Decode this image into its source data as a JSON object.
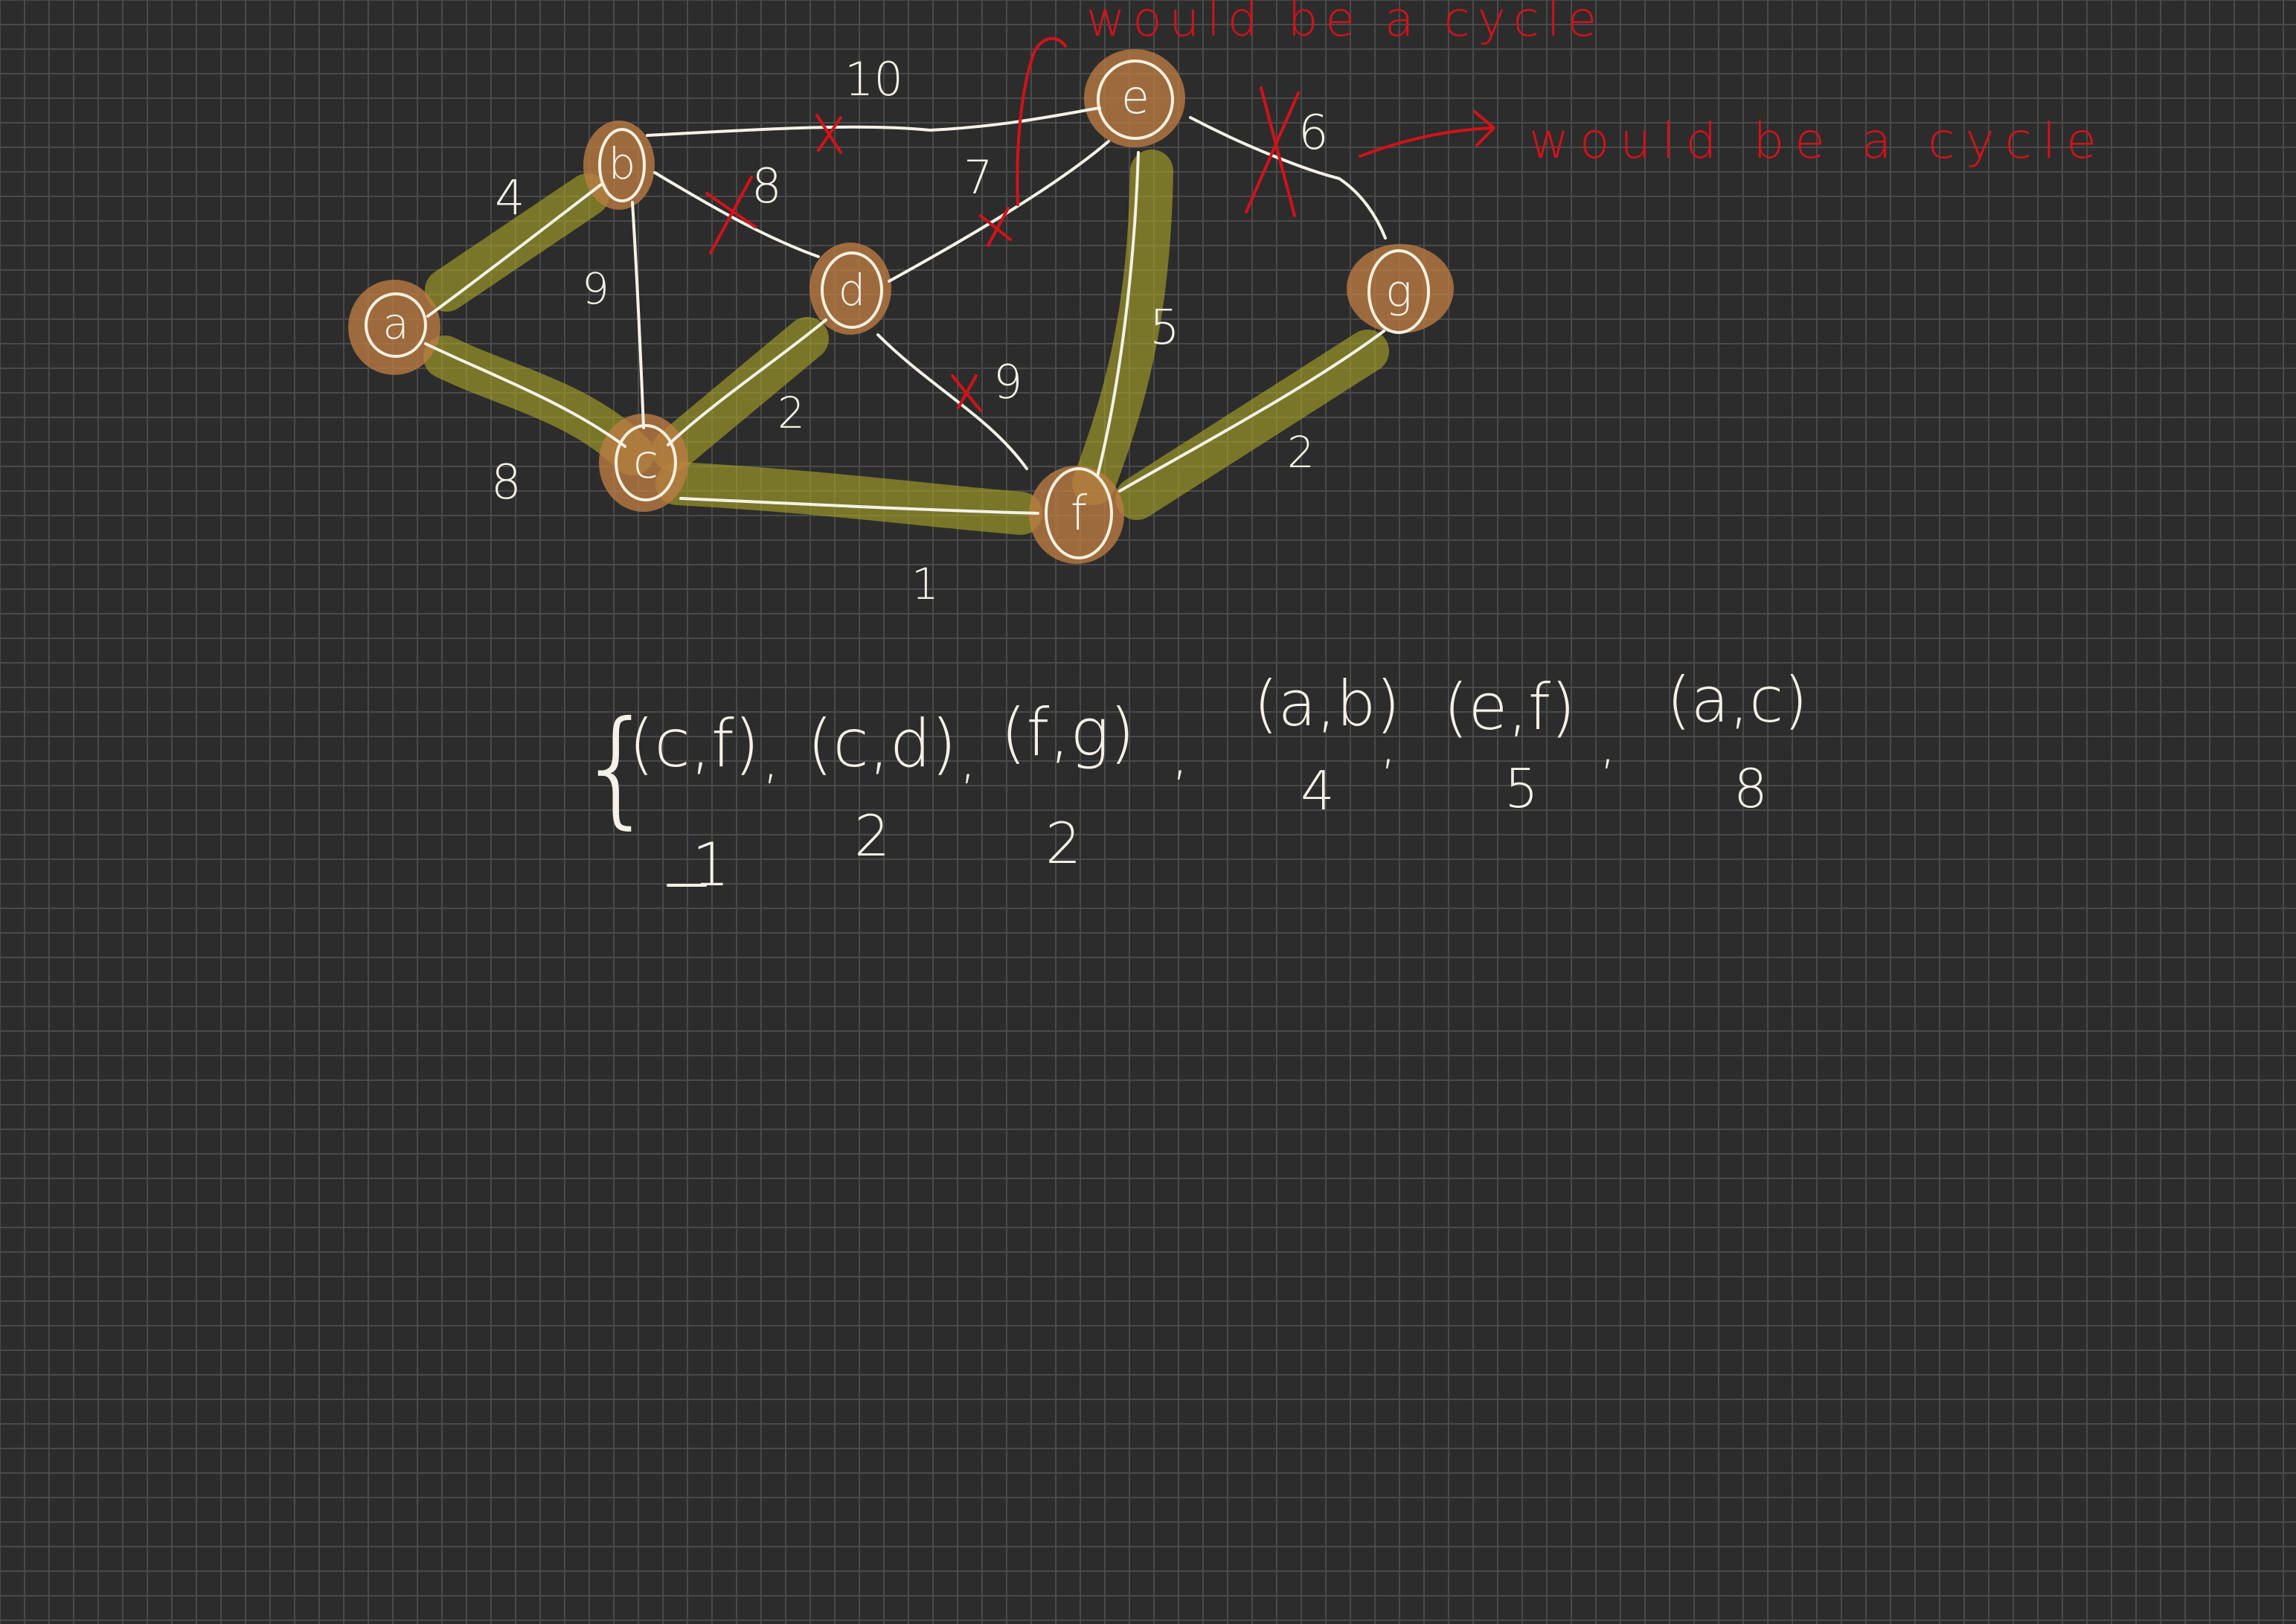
{
  "graph": {
    "nodes": [
      {
        "id": "a",
        "label": "a"
      },
      {
        "id": "b",
        "label": "b"
      },
      {
        "id": "c",
        "label": "c"
      },
      {
        "id": "d",
        "label": "d"
      },
      {
        "id": "e",
        "label": "e"
      },
      {
        "id": "f",
        "label": "f"
      },
      {
        "id": "g",
        "label": "g"
      }
    ],
    "edges": [
      {
        "id": "a-b",
        "weight": "4",
        "in_tree": true,
        "crossed": false
      },
      {
        "id": "a-c",
        "weight": "8",
        "in_tree": true,
        "crossed": false
      },
      {
        "id": "b-c",
        "weight": "9",
        "in_tree": false,
        "crossed": false
      },
      {
        "id": "b-e",
        "weight": "10",
        "in_tree": false,
        "crossed": true
      },
      {
        "id": "b-d",
        "weight": "8",
        "in_tree": false,
        "crossed": true
      },
      {
        "id": "c-d",
        "weight": "2",
        "in_tree": true,
        "crossed": false
      },
      {
        "id": "c-f",
        "weight": "1",
        "in_tree": true,
        "crossed": false
      },
      {
        "id": "d-e",
        "weight": "7",
        "in_tree": false,
        "crossed": true
      },
      {
        "id": "d-f",
        "weight": "9",
        "in_tree": false,
        "crossed": true
      },
      {
        "id": "e-f",
        "weight": "5",
        "in_tree": true,
        "crossed": false
      },
      {
        "id": "e-g",
        "weight": "6",
        "in_tree": false,
        "crossed": true
      },
      {
        "id": "f-g",
        "weight": "2",
        "in_tree": true,
        "crossed": false
      }
    ]
  },
  "annotations": {
    "cycle_note_top": "would be a cycle",
    "cycle_note_right": "would be a cycle"
  },
  "edge_list": {
    "open_brace": "{",
    "items": [
      {
        "pair": "(c,f)",
        "weight": "1"
      },
      {
        "pair": "(c,d)",
        "weight": "2"
      },
      {
        "pair": "(f,g)",
        "weight": "2"
      },
      {
        "pair": "(a,b)",
        "weight": "4"
      },
      {
        "pair": "(e,f)",
        "weight": "5"
      },
      {
        "pair": "(a,c)",
        "weight": "8"
      }
    ],
    "separator": ","
  },
  "colors": {
    "background": "#2c2c2c",
    "grid": "#4a4a4a",
    "ink": "#f4f1e8",
    "highlight": "#aaa528",
    "node_fill": "#bc7c42",
    "cross_out": "#d3121a"
  }
}
